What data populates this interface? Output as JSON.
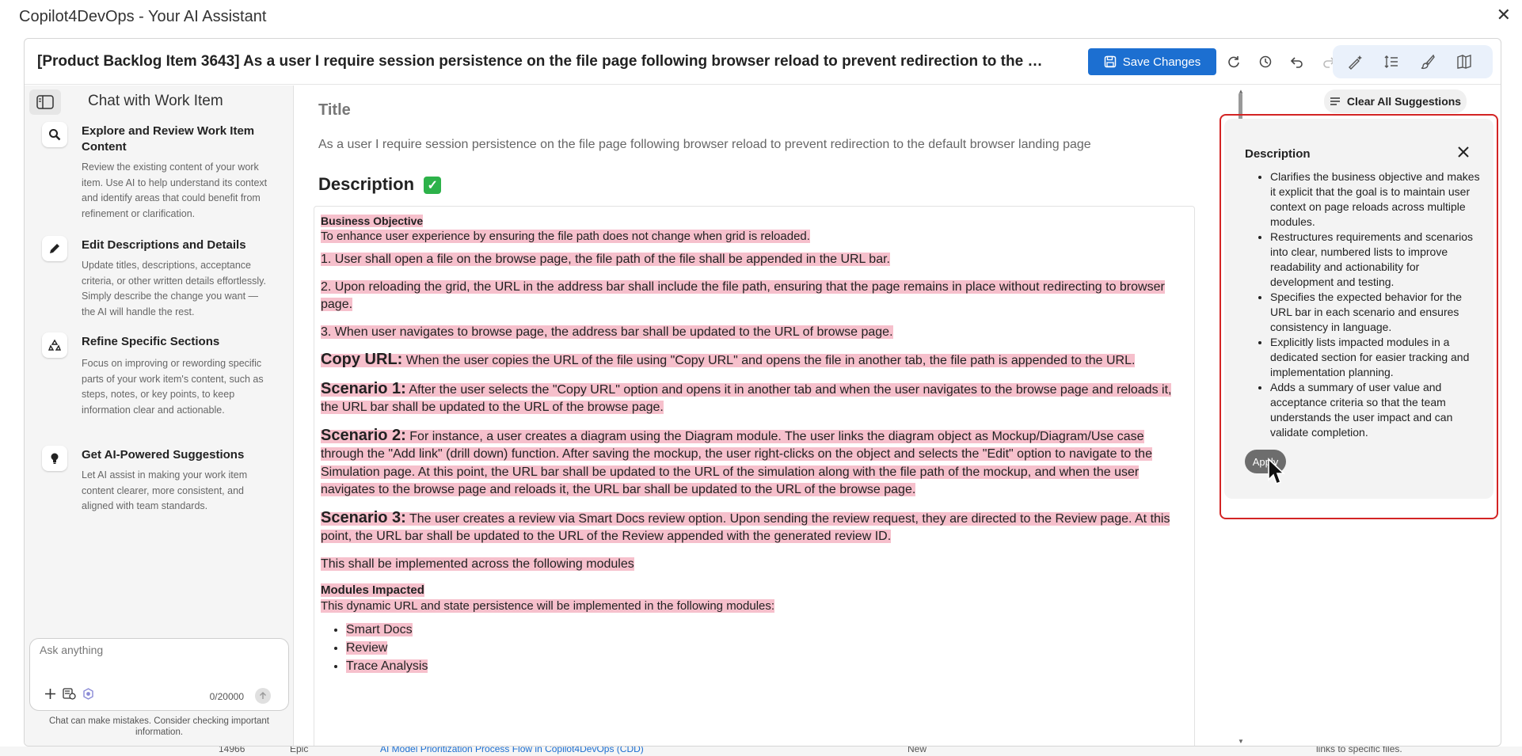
{
  "window": {
    "title": "Copilot4DevOps - Your AI Assistant",
    "close_glyph": "✕"
  },
  "header": {
    "work_item_title": "[Product Backlog Item 3643] As a user I require session persistence on the file page following browser reload to prevent redirection to the default bro...",
    "save_label": "Save Changes"
  },
  "sidebar": {
    "title": "Chat with Work Item",
    "features": [
      {
        "icon": "search-icon",
        "heading": "Explore and Review Work Item Content",
        "desc": "Review the existing content of your work item. Use AI to help understand its context and identify areas that could benefit from refinement or clarification."
      },
      {
        "icon": "pencil-icon",
        "heading": "Edit Descriptions and Details",
        "desc": "Update titles, descriptions, acceptance criteria, or other written details effortlessly. Simply describe the change you want — the AI will handle the rest."
      },
      {
        "icon": "recycle-icon",
        "heading": "Refine Specific Sections",
        "desc": "Focus on improving or rewording specific parts of your work item's content, such as steps, notes, or key points, to keep information clear and actionable."
      },
      {
        "icon": "lightbulb-icon",
        "heading": "Get AI-Powered Suggestions",
        "desc": "Let AI assist in making your work item content clearer, more consistent, and aligned with team standards."
      }
    ],
    "chat": {
      "placeholder": "Ask anything",
      "counter": "0/20000",
      "note": "Chat can make mistakes. Consider checking important information."
    }
  },
  "main": {
    "title_label": "Title",
    "title_value": "As a user I require session persistence on the file page following browser reload to prevent redirection to the default browser landing page",
    "description_label": "Description",
    "content": {
      "business_objective_head": "Business Objective",
      "business_objective": "To enhance user experience by ensuring the file path does not change when grid is reloaded.",
      "step1": "1. User shall open a file on the browse page, the file path of the file shall be appended in the URL bar.",
      "step2": "2. Upon reloading the grid, the URL in the address bar shall include the file path, ensuring that the page remains in place without redirecting to browser page.",
      "step3": "3. When user navigates to browse page, the address bar shall be updated to the URL of browse page.",
      "copy_url_head": "Copy URL:",
      "copy_url_text": " When the user copies the URL of the file using \"Copy URL\" and opens the file in another tab, the file path is appended to the URL.",
      "s1_head": "Scenario 1:",
      "s1_text": " After the user selects the \"Copy URL\" option and opens it in another tab and when the user navigates to the browse page and reloads it, the URL bar shall be updated to the URL of the browse page.",
      "s2_head": "Scenario 2:",
      "s2_text": " For instance, a user creates a diagram using the Diagram module. The user links the diagram object as Mockup/Diagram/Use case through the \"Add link\" (drill down) function. After saving the mockup, the user right-clicks on the object and selects the \"Edit\" option to navigate to the Simulation page. At this point, the URL bar shall be updated to the URL of the simulation along with the file path of the mockup, and when the user navigates to the browse page and reloads it, the URL bar shall be updated to the URL of the browse page.",
      "s3_head": "Scenario 3:",
      "s3_text": " The user creates a review via Smart Docs review option. Upon sending the review request, they are directed to the Review page. At this point, the URL bar shall be updated to the URL of the Review appended with the generated review ID.",
      "modules_line": "This shall be implemented across the following modules",
      "modules_head": "Modules Impacted",
      "modules_intro": "This dynamic URL and state persistence will be implemented in the following modules:",
      "modules": [
        "Smart Docs",
        "Review",
        "Trace Analysis"
      ]
    }
  },
  "suggestions": {
    "clear_label": "Clear All Suggestions",
    "card_title": "Description",
    "items": [
      "Clarifies the business objective and makes it explicit that the goal is to maintain user context on page reloads across multiple modules.",
      "Restructures requirements and scenarios into clear, numbered lists to improve readability and actionability for development and testing.",
      "Specifies the expected behavior for the URL bar in each scenario and ensures consistency in language.",
      "Explicitly lists impacted modules in a dedicated section for easier tracking and implementation planning.",
      "Adds a summary of user value and acceptance criteria so that the team understands the user impact and can validate completion."
    ],
    "apply_label": "Apply"
  },
  "underlying": {
    "id": "14966",
    "type": "Epic",
    "title": "AI Model Prioritization Process Flow in Copilot4DevOps (CDD)",
    "state": "New",
    "extra": "links to specific files."
  },
  "colors": {
    "accent": "#1c6fd1",
    "highlight": "#f6c0cc",
    "selection_border": "#d32424",
    "check": "#2db24a"
  }
}
